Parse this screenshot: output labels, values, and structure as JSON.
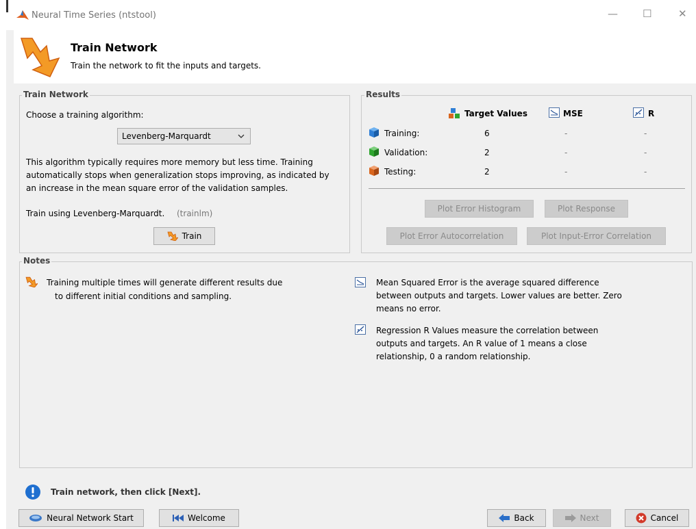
{
  "window": {
    "title": "Neural Time Series (ntstool)",
    "minimize": "—",
    "maximize": "☐",
    "close": "✕"
  },
  "header": {
    "title": "Train Network",
    "subtitle": "Train the network to fit the inputs and targets."
  },
  "train_panel": {
    "legend": "Train Network",
    "choose_label": "Choose a training algorithm:",
    "algorithm": "Levenberg-Marquardt",
    "description": [
      "This algorithm typically requires more memory but less time. Training",
      "automatically stops when generalization stops improving, as indicated by",
      "an increase in the mean square error of the validation samples."
    ],
    "train_using": "Train using Levenberg-Marquardt.",
    "train_fn": "(trainlm)",
    "train_button": "Train"
  },
  "results": {
    "legend": "Results",
    "col_target": "Target Values",
    "col_mse": "MSE",
    "col_r": "R",
    "rows": [
      {
        "label": "Training:",
        "target": "6",
        "mse": "-",
        "r": "-",
        "color": "#2f7fd6"
      },
      {
        "label": "Validation:",
        "target": "2",
        "mse": "-",
        "r": "-",
        "color": "#2fa52f"
      },
      {
        "label": "Testing:",
        "target": "2",
        "mse": "-",
        "r": "-",
        "color": "#d9661e"
      }
    ],
    "plot_error_histogram": "Plot Error Histogram",
    "plot_response": "Plot Response",
    "plot_error_autocorrelation": "Plot Error Autocorrelation",
    "plot_input_error_correlation": "Plot Input-Error Correlation"
  },
  "notes": {
    "legend": "Notes",
    "note1": [
      "Training multiple times will generate different results due",
      "to different initial conditions and sampling."
    ],
    "note2": [
      "Mean Squared Error is the average squared difference",
      "between outputs and targets. Lower values are better. Zero",
      "means no error."
    ],
    "note3": [
      "Regression R Values measure the correlation between",
      "outputs and targets. An R value of 1 means a close",
      "relationship, 0 a random relationship."
    ]
  },
  "status": {
    "message": "Train network, then click [Next]."
  },
  "footer": {
    "nn_start": "Neural Network Start",
    "welcome": "Welcome",
    "back": "Back",
    "next": "Next",
    "cancel": "Cancel"
  }
}
